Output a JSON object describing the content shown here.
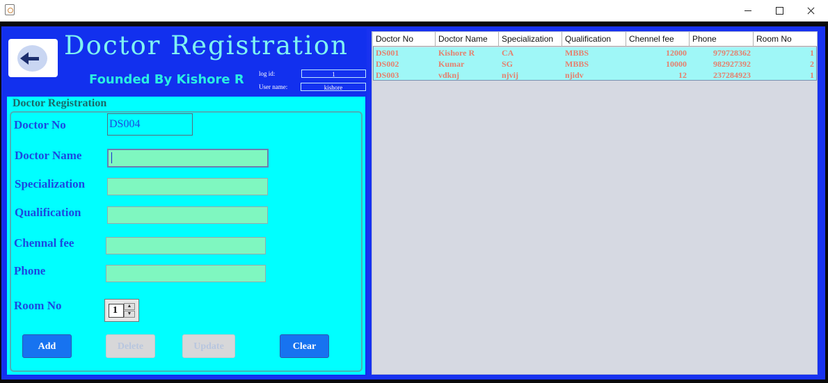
{
  "app": {
    "title_big": "Doctor Registration",
    "founded_by": "Founded By Kishore R"
  },
  "login": {
    "log_id_label": "log id:",
    "log_id_value": "1",
    "user_name_label": "User name:",
    "user_name_value": "kishore"
  },
  "form": {
    "panel_title": "Doctor Registration",
    "doctor_no_label": "Doctor No",
    "doctor_no_value": "DS004",
    "doctor_name_label": "Doctor Name",
    "specialization_label": "Specialization",
    "qualification_label": "Qualification",
    "chennal_fee_label": "Chennal fee",
    "phone_label": "Phone",
    "room_no_label": "Room No",
    "room_no_value": "1",
    "buttons": {
      "add": "Add",
      "delete": "Delete",
      "update": "Update",
      "clear": "Clear"
    }
  },
  "table": {
    "columns": [
      "Doctor No",
      "Doctor Name",
      "Specialization",
      "Qualification",
      "Chennel fee",
      "Phone",
      "Room No"
    ],
    "rows": [
      [
        "DS001",
        "Kishore R",
        "CA",
        "MBBS",
        "12000",
        "979728362",
        "1"
      ],
      [
        "DS002",
        "Kumar",
        "SG",
        "MBBS",
        "10000",
        "982927392",
        "2"
      ],
      [
        "DS003",
        "vdknj",
        "njvij",
        "njidv",
        "12",
        "237284923",
        "1"
      ]
    ]
  },
  "colors": {
    "frame_blue": "#1832f0",
    "panel_cyan": "#00ffff",
    "field_green": "#7ff7c0",
    "row_text": "#e5806e"
  },
  "icons": {
    "back": "arrow-left-icon",
    "app": "java-app-icon"
  }
}
